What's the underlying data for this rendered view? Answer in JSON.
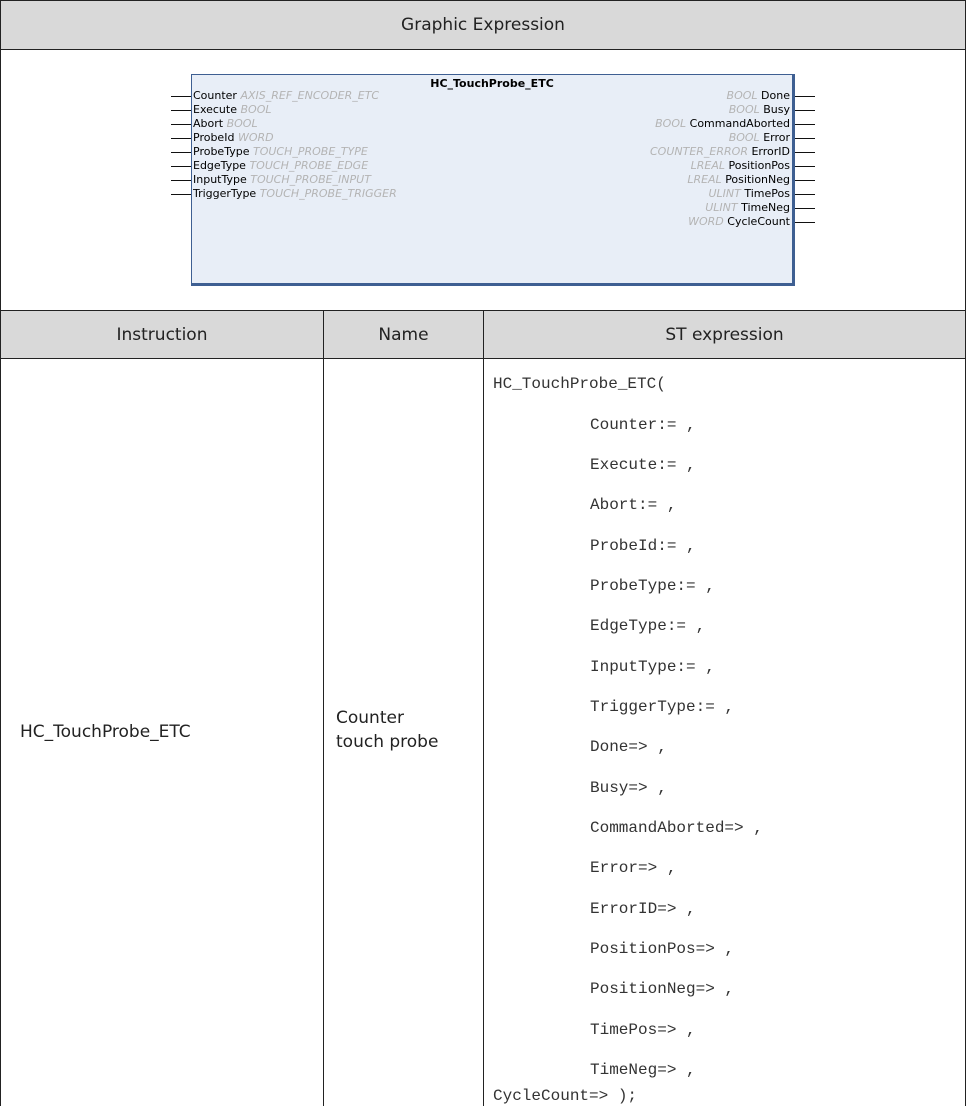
{
  "header": {
    "graphic_label": "Graphic Expression",
    "col_instruction": "Instruction",
    "col_name": "Name",
    "col_st": "ST expression"
  },
  "function_block": {
    "title": "HC_TouchProbe_ETC",
    "inputs": [
      {
        "name": "Counter",
        "type": "AXIS_REF_ENCODER_ETC"
      },
      {
        "name": "Execute",
        "type": "BOOL"
      },
      {
        "name": "Abort",
        "type": "BOOL"
      },
      {
        "name": "ProbeId",
        "type": "WORD"
      },
      {
        "name": "ProbeType",
        "type": "TOUCH_PROBE_TYPE"
      },
      {
        "name": "EdgeType",
        "type": "TOUCH_PROBE_EDGE"
      },
      {
        "name": "InputType",
        "type": "TOUCH_PROBE_INPUT"
      },
      {
        "name": "TriggerType",
        "type": "TOUCH_PROBE_TRIGGER"
      }
    ],
    "outputs": [
      {
        "name": "Done",
        "type": "BOOL"
      },
      {
        "name": "Busy",
        "type": "BOOL"
      },
      {
        "name": "CommandAborted",
        "type": "BOOL"
      },
      {
        "name": "Error",
        "type": "BOOL"
      },
      {
        "name": "ErrorID",
        "type": "COUNTER_ERROR"
      },
      {
        "name": "PositionPos",
        "type": "LREAL"
      },
      {
        "name": "PositionNeg",
        "type": "LREAL"
      },
      {
        "name": "TimePos",
        "type": "ULINT"
      },
      {
        "name": "TimeNeg",
        "type": "ULINT"
      },
      {
        "name": "CycleCount",
        "type": "WORD"
      }
    ]
  },
  "row": {
    "instruction": "HC_TouchProbe_ETC",
    "name_line1": "Counter",
    "name_line2": "touch probe",
    "st_lines": [
      "HC_TouchProbe_ETC(",
      "Counter:= ,",
      "Execute:= ,",
      "Abort:= ,",
      "ProbeId:= ,",
      "ProbeType:= ,",
      "EdgeType:= ,",
      "InputType:= ,",
      "TriggerType:= ,",
      "Done=> ,",
      "Busy=> ,",
      "CommandAborted=> ,",
      "Error=> ,",
      "ErrorID=> ,",
      "PositionPos=> ,",
      "PositionNeg=> ,",
      "TimePos=> ,",
      "TimeNeg=> ,",
      "CycleCount=> );"
    ]
  }
}
